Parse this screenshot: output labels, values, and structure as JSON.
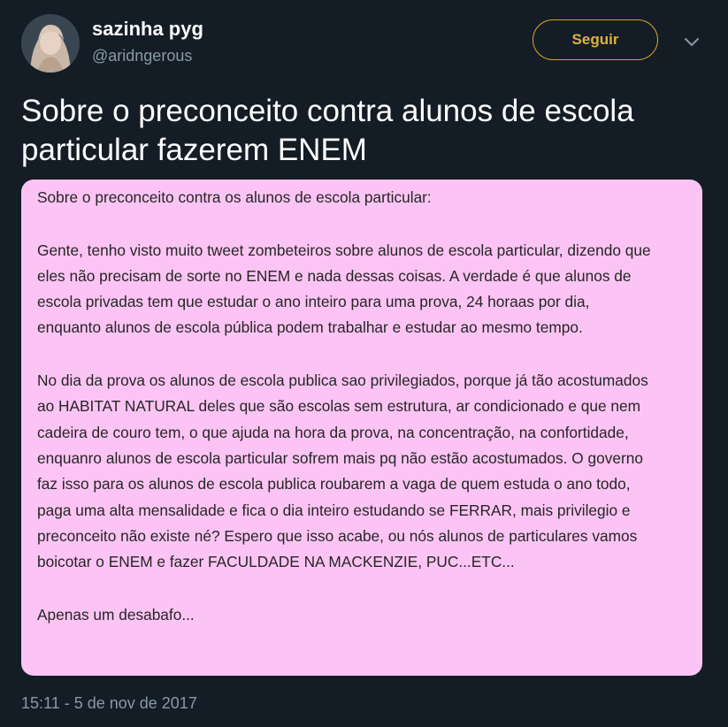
{
  "user": {
    "name": "sazinha pyg",
    "handle": "@aridngerous"
  },
  "actions": {
    "follow_label": "Seguir"
  },
  "tweet": {
    "text": "Sobre o preconceito contra alunos de escola particular fazerem ENEM",
    "timestamp": "15:11 - 5 de nov de 2017"
  },
  "image": {
    "lines": [
      "Sobre o preconceito contra os alunos de escola particular:",
      "Gente, tenho visto muito tweet zombeteiros sobre alunos de escola particular, dizendo que",
      "eles não precisam de sorte no ENEM e nada dessas coisas. A verdade é que alunos de",
      "escola  privadas tem que estudar o ano inteiro para uma prova, 24 horaas por dia,",
      "enquanto alunos de escola pública podem trabalhar e estudar ao mesmo tempo.",
      "No dia da prova os alunos de escola publica sao privilegiados, porque já tão acostumados",
      "ao HABITAT NATURAL deles que são escolas sem estrutura, ar condicionado e que nem",
      "cadeira de couro tem, o que ajuda na hora da prova, na concentração, na confortidade,",
      "enquanro alunos de escola particular sofrem mais pq não estão acostumados. O governo",
      "faz isso para os alunos de escola publica roubarem a vaga de quem estuda o ano todo,",
      "paga uma alta mensalidade e fica o dia inteiro estudando se FERRAR, mais privilegio e",
      "preconceito não existe né? Espero que isso acabe, ou nós alunos de particulares vamos",
      "boicotar o ENEM e fazer FACULDADE NA MACKENZIE, PUC...ETC...",
      "Apenas um desabafo..."
    ]
  },
  "icons": {
    "menu": "chevron-down-icon",
    "avatar": "profile-photo"
  },
  "colors": {
    "background": "#141d26",
    "accent": "#e0b040",
    "image_background": "#fcc4f4",
    "image_text": "#262626",
    "secondary_text": "#8899a6"
  }
}
